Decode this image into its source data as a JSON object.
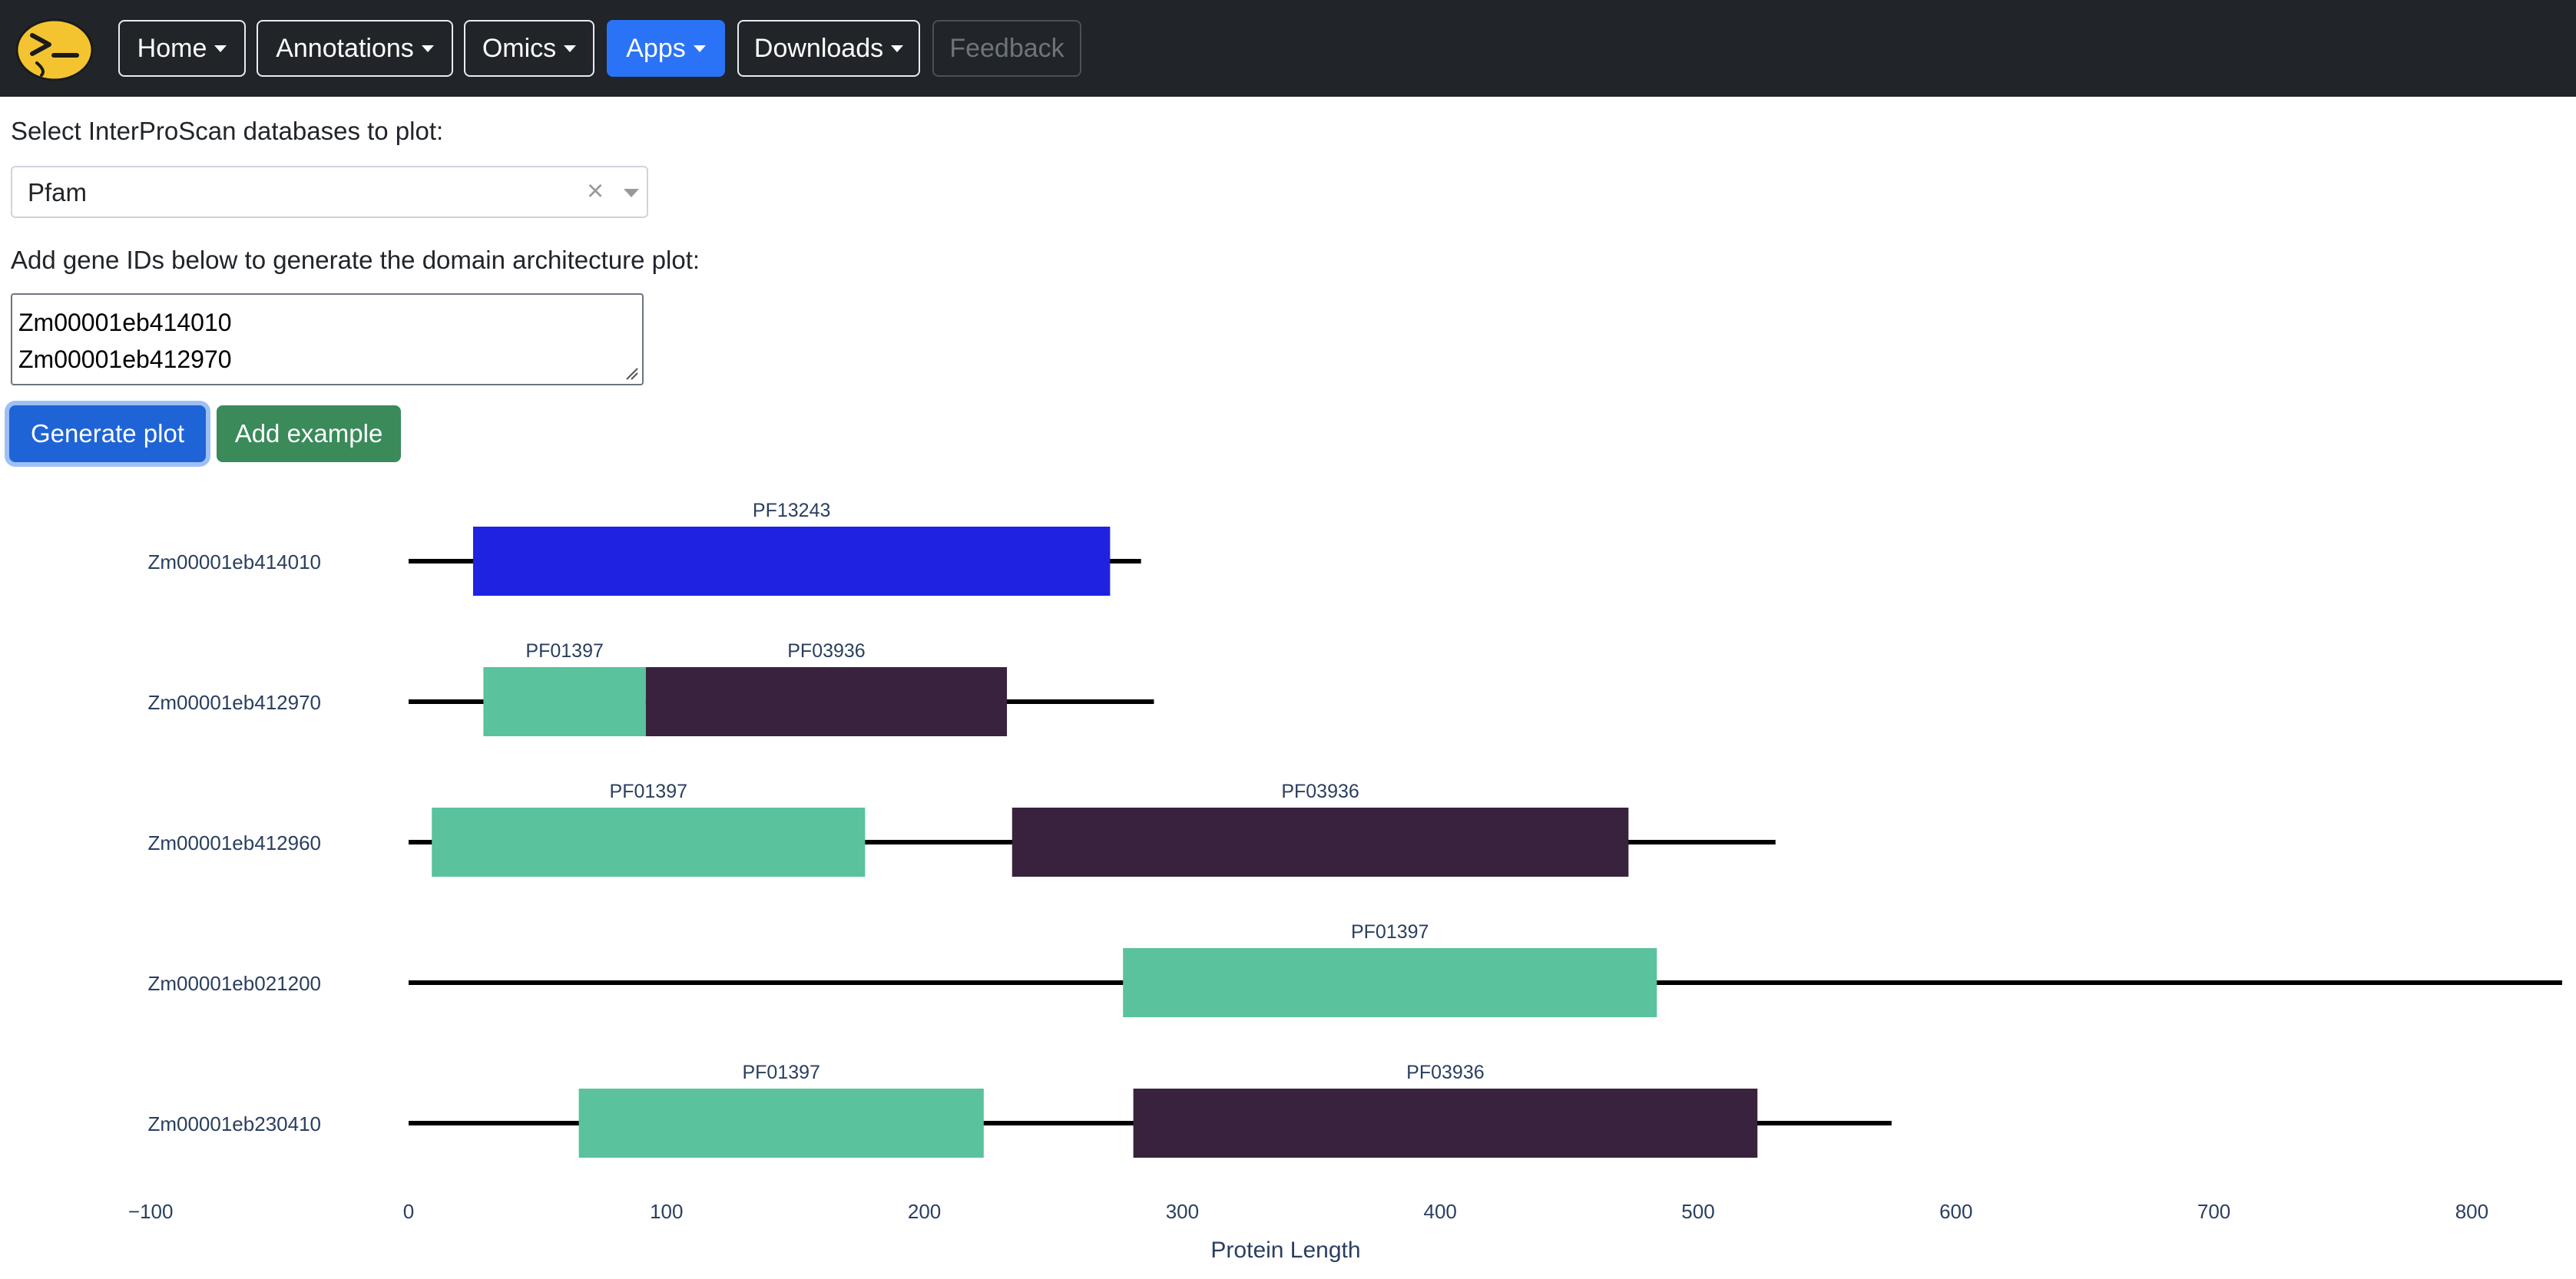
{
  "navbar": {
    "items": [
      {
        "label": "Home",
        "caret": true
      },
      {
        "label": "Annotations",
        "caret": true
      },
      {
        "label": "Omics",
        "caret": true
      },
      {
        "label": "Apps",
        "caret": true,
        "active": true
      },
      {
        "label": "Downloads",
        "caret": true
      },
      {
        "label": "Feedback",
        "disabled": true
      }
    ],
    "logo_icon": "terminal-face-logo-icon"
  },
  "form": {
    "db_label": "Select InterProScan databases to plot:",
    "db_selected": "Pfam",
    "db_clear": "×",
    "genes_label": "Add gene IDs below to generate the domain architecture plot:",
    "genes_lines": [
      "Zm00001eb414010",
      "Zm00001eb412970"
    ],
    "generate_label": "Generate plot",
    "example_label": "Add example"
  },
  "chart_data": {
    "type": "bar",
    "orientation": "horizontal",
    "xlabel": "Protein Length",
    "xlim": [
      -100,
      835
    ],
    "xticks": [
      -100,
      0,
      100,
      200,
      300,
      400,
      500,
      600,
      700,
      800
    ],
    "xtick_labels": [
      "−100",
      "0",
      "100",
      "200",
      "300",
      "400",
      "500",
      "600",
      "700",
      "800"
    ],
    "proteins": [
      {
        "id": "Zm00001eb414010",
        "length": 284,
        "domains": [
          {
            "name": "PF13243",
            "start": 25,
            "end": 272,
            "color": "#1f22e0"
          }
        ]
      },
      {
        "id": "Zm00001eb412970",
        "length": 289,
        "domains": [
          {
            "name": "PF01397",
            "start": 29,
            "end": 92,
            "color": "#5ac29c"
          },
          {
            "name": "PF03936",
            "start": 92,
            "end": 232,
            "color": "#38223d"
          }
        ]
      },
      {
        "id": "Zm00001eb412960",
        "length": 530,
        "domains": [
          {
            "name": "PF01397",
            "start": 9,
            "end": 177,
            "color": "#5ac29c"
          },
          {
            "name": "PF03936",
            "start": 234,
            "end": 473,
            "color": "#38223d"
          }
        ]
      },
      {
        "id": "Zm00001eb021200",
        "length": 835,
        "domains": [
          {
            "name": "PF01397",
            "start": 277,
            "end": 484,
            "color": "#5ac29c"
          }
        ]
      },
      {
        "id": "Zm00001eb230410",
        "length": 575,
        "domains": [
          {
            "name": "PF01397",
            "start": 66,
            "end": 223,
            "color": "#5ac29c"
          },
          {
            "name": "PF03936",
            "start": 281,
            "end": 523,
            "color": "#38223d"
          }
        ]
      }
    ],
    "grid": false,
    "legend": "none"
  }
}
